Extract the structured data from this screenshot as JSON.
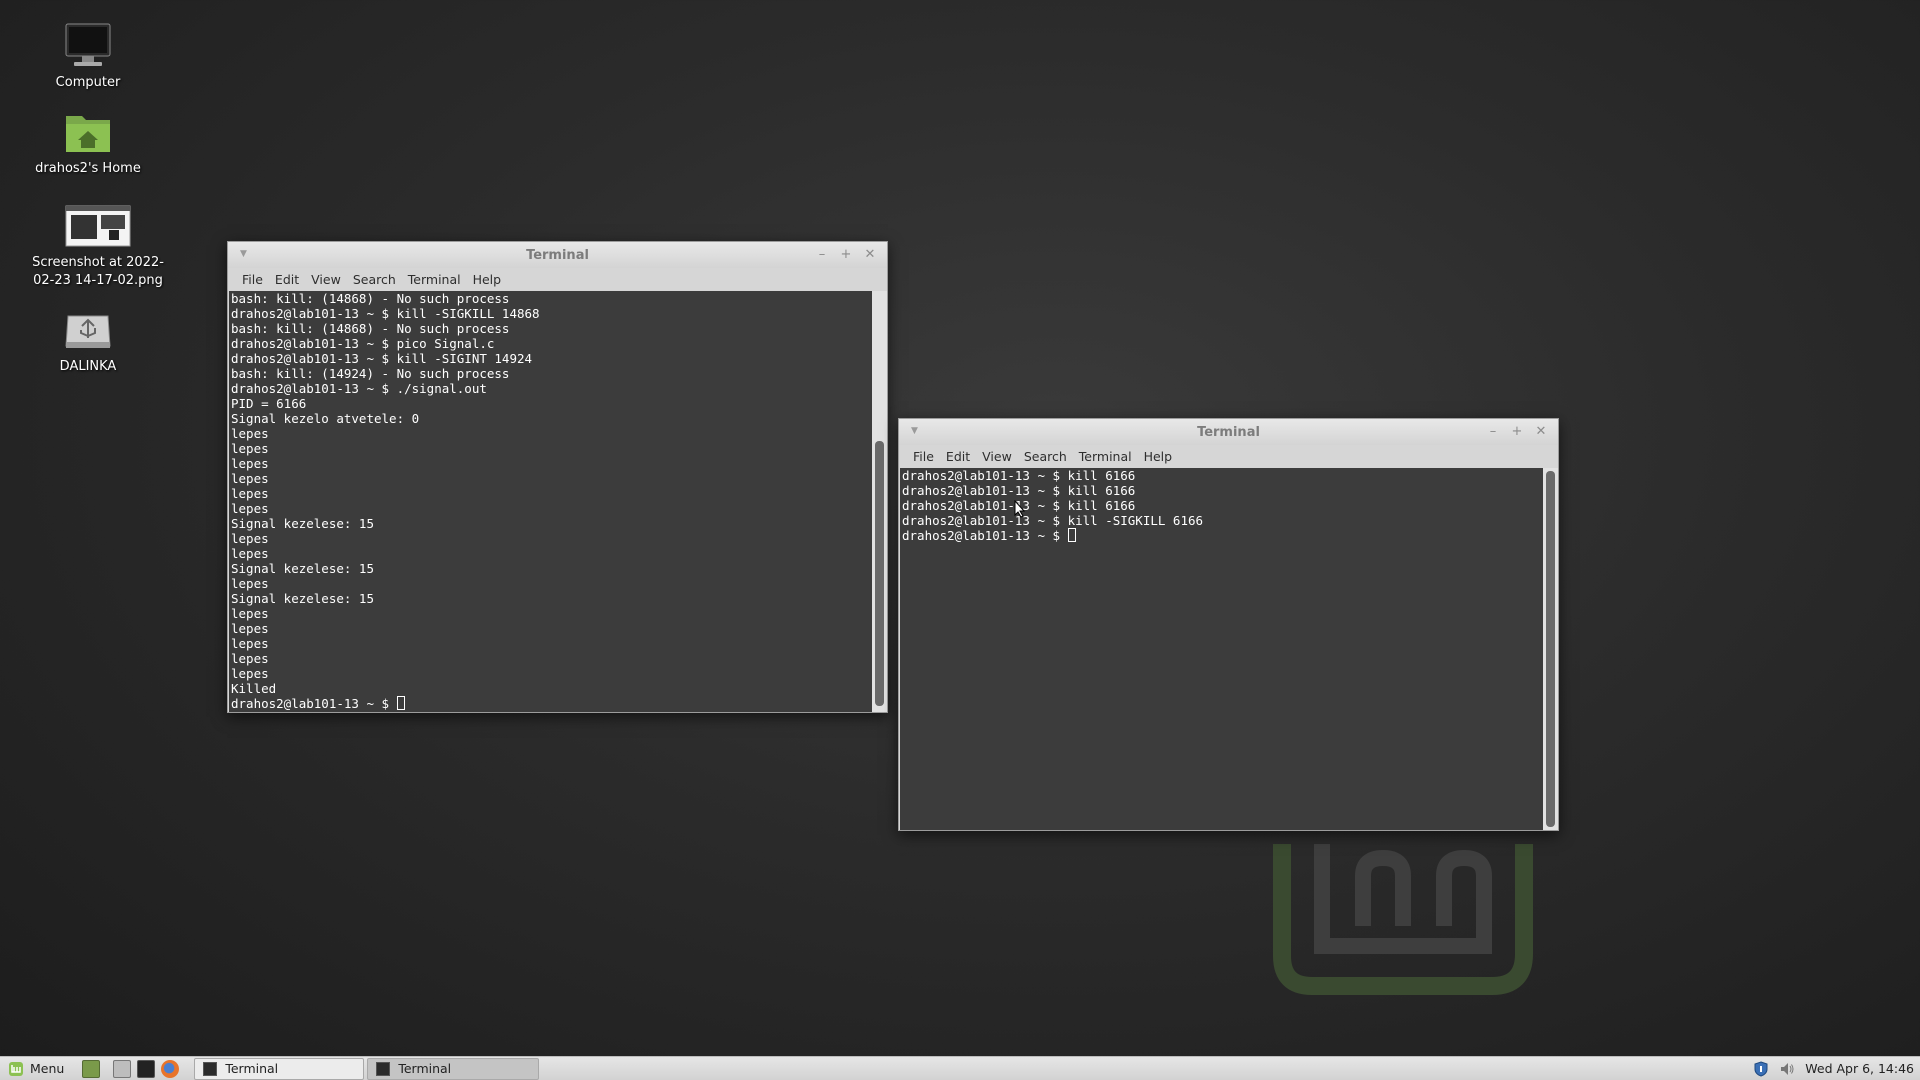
{
  "desktop": {
    "icons": [
      {
        "label": "Computer",
        "icon": "computer-icon"
      },
      {
        "label": "drahos2's Home",
        "icon": "home-folder-icon"
      },
      {
        "label": "Screenshot at 2022-02-23 14-17-02.png",
        "icon": "image-file-icon"
      },
      {
        "label": "DALINKA",
        "icon": "usb-drive-icon"
      }
    ]
  },
  "window1": {
    "title": "Terminal",
    "menu": [
      "File",
      "Edit",
      "View",
      "Search",
      "Terminal",
      "Help"
    ],
    "lines": [
      "bash: kill: (14868) - No such process",
      "drahos2@lab101-13 ~ $ kill -SIGKILL 14868",
      "bash: kill: (14868) - No such process",
      "drahos2@lab101-13 ~ $ pico Signal.c",
      "drahos2@lab101-13 ~ $ kill -SIGINT 14924",
      "bash: kill: (14924) - No such process",
      "drahos2@lab101-13 ~ $ ./signal.out",
      "PID = 6166",
      "Signal kezelo atvetele: 0",
      "lepes",
      "lepes",
      "lepes",
      "lepes",
      "lepes",
      "lepes",
      "Signal kezelese: 15",
      "lepes",
      "lepes",
      "Signal kezelese: 15",
      "lepes",
      "Signal kezelese: 15",
      "lepes",
      "lepes",
      "lepes",
      "lepes",
      "lepes",
      "Killed"
    ],
    "prompt": "drahos2@lab101-13 ~ $ "
  },
  "window2": {
    "title": "Terminal",
    "menu": [
      "File",
      "Edit",
      "View",
      "Search",
      "Terminal",
      "Help"
    ],
    "lines": [
      "drahos2@lab101-13 ~ $ kill 6166",
      "drahos2@lab101-13 ~ $ kill 6166",
      "drahos2@lab101-13 ~ $ kill 6166",
      "drahos2@lab101-13 ~ $ kill -SIGKILL 6166"
    ],
    "prompt": "drahos2@lab101-13 ~ $ "
  },
  "panel": {
    "menu_label": "Menu",
    "launchers": [
      "show-desktop-icon",
      "file-manager-icon",
      "terminal-icon",
      "firefox-icon"
    ],
    "tasks": [
      {
        "label": "Terminal"
      },
      {
        "label": "Terminal"
      }
    ],
    "clock": "Wed Apr  6, 14:46"
  },
  "colors": {
    "terminal_bg": "#3c3c3c",
    "mint_green": "#8cc152",
    "panel_bg": "#dcdcdc"
  }
}
